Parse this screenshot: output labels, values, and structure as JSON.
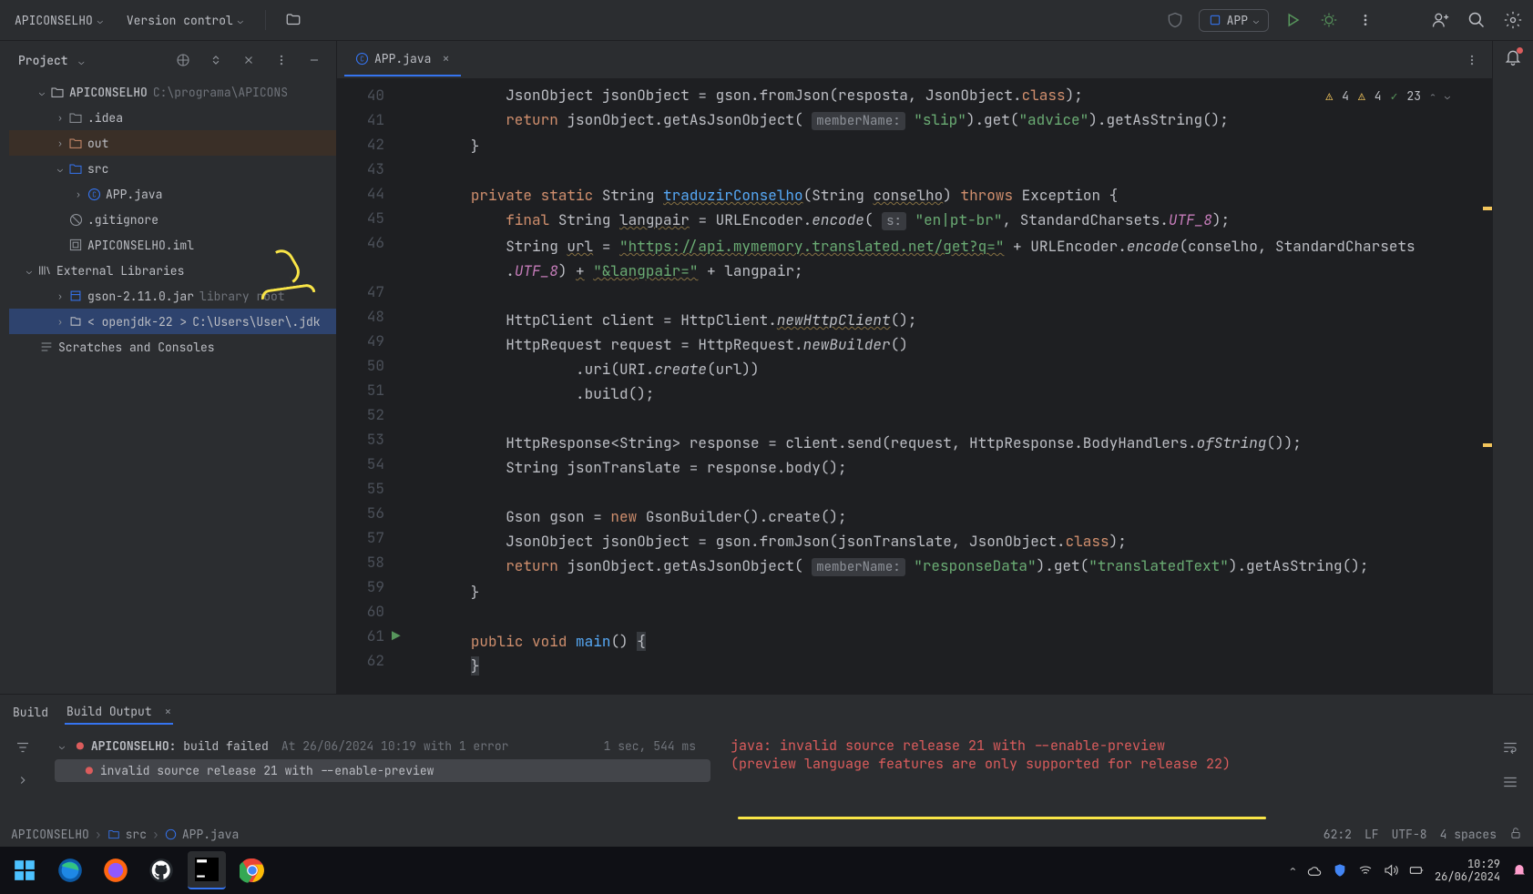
{
  "toolbar": {
    "project": "APICONSELHO",
    "vcs": "Version control",
    "run_config": "APP"
  },
  "project_panel": {
    "title": "Project",
    "root": {
      "name": "APICONSELHO",
      "path": "C:\\programa\\APICONS"
    },
    "nodes": {
      "idea": ".idea",
      "out": "out",
      "src": "src",
      "app": "APP.java",
      "gitignore": ".gitignore",
      "iml": "APICONSELHO.iml",
      "ext": "External Libraries",
      "gson": "gson-2.11.0.jar",
      "gson_note": "library root",
      "jdk": "< openjdk-22 >",
      "jdk_path": "C:\\Users\\User\\.jdk",
      "scratches": "Scratches and Consoles"
    }
  },
  "tabs": {
    "active": "APP.java"
  },
  "inspections": {
    "warn1": "4",
    "warn2": "4",
    "check": "23"
  },
  "code_lines": [
    {
      "n": 40,
      "code": "            JsonObject jsonObject = gson.fromJson(resposta, JsonObject.<span class='kw'>class</span>);"
    },
    {
      "n": 41,
      "code": "            <span class='kw'>return</span> jsonObject.getAsJsonObject( <span class='hint'>memberName:</span> <span class='str'>\"slip\"</span>).get(<span class='str'>\"advice\"</span>).getAsString();"
    },
    {
      "n": 42,
      "code": "        }"
    },
    {
      "n": 43,
      "code": ""
    },
    {
      "n": 44,
      "code": "        <span class='kw'>private static</span> String <span class='fn ul'>traduzirConselho</span>(String <span class='ul'>conselho</span>) <span class='kw'>throws</span> Exception {"
    },
    {
      "n": 45,
      "code": "            <span class='kw'>final</span> String <span class='ul'>langpair</span> = URLEncoder.<span class='italic'>encode</span>( <span class='hint'>s:</span> <span class='str'>\"en|pt-br\"</span>, StandardCharsets.<span class='field'>UTF_8</span>);"
    },
    {
      "n": 46,
      "code": "            String <span class='ul'>url</span> = <span class='str ul'>\"https://api.mymemory.translated.net/get?q=\"</span> + URLEncoder.<span class='italic'>encode</span>(conselho, StandardCharsets\n            .<span class='field'>UTF_8</span>) <span class='ul'>+</span> <span class='str ul'>\"&langpair=\"</span> + langpair;"
    },
    {
      "n": 47,
      "code": ""
    },
    {
      "n": 48,
      "code": "            HttpClient client = HttpClient.<span class='italic ul'>newHttpClient</span>();"
    },
    {
      "n": 49,
      "code": "            HttpRequest request = HttpRequest.<span class='italic'>newBuilder</span>()"
    },
    {
      "n": 50,
      "code": "                    .uri(URI.<span class='italic'>create</span>(url))"
    },
    {
      "n": 51,
      "code": "                    .build();"
    },
    {
      "n": 52,
      "code": ""
    },
    {
      "n": 53,
      "code": "            HttpResponse&lt;String&gt; response = client.send(request, HttpResponse.BodyHandlers.<span class='italic'>ofString</span>());"
    },
    {
      "n": 54,
      "code": "            String jsonTranslate = response.body();"
    },
    {
      "n": 55,
      "code": ""
    },
    {
      "n": 56,
      "code": "            Gson gson = <span class='kw'>new</span> GsonBuilder().create();"
    },
    {
      "n": 57,
      "code": "            JsonObject jsonObject = gson.fromJson(jsonTranslate, JsonObject.<span class='kw'>class</span>);"
    },
    {
      "n": 58,
      "code": "            <span class='kw'>return</span> jsonObject.getAsJsonObject( <span class='hint'>memberName:</span> <span class='str'>\"responseData\"</span>).get(<span class='str'>\"translatedText\"</span>).getAsString();"
    },
    {
      "n": 59,
      "code": "        }"
    },
    {
      "n": 60,
      "code": ""
    },
    {
      "n": 61,
      "code": "        <span class='kw'>public void</span> <span class='fn'>main</span>() <span style='background:#373a3f'>{</span>",
      "run": true
    },
    {
      "n": 62,
      "code": "        <span style='background:#373a3f'>}</span>"
    }
  ],
  "build": {
    "tab1": "Build",
    "tab2": "Build Output",
    "title_prefix": "APICONSELHO:",
    "title_status": " build failed",
    "title_at": "At 26/06/2024 10:19 with 1 error",
    "timing": "1 sec, 544 ms",
    "sub_error": "invalid source release 21 with --enable-preview",
    "output_l1": "java: invalid source release 21 with --enable-preview",
    "output_l2": "  (preview language features are only supported for release 22)"
  },
  "breadcrumb": {
    "p1": "APICONSELHO",
    "p2": "src",
    "p3": "APP.java"
  },
  "status": {
    "pos": "62:2",
    "eol": "LF",
    "enc": "UTF-8",
    "indent": "4 spaces"
  },
  "taskbar": {
    "time": "10:29",
    "date": "26/06/2024"
  }
}
